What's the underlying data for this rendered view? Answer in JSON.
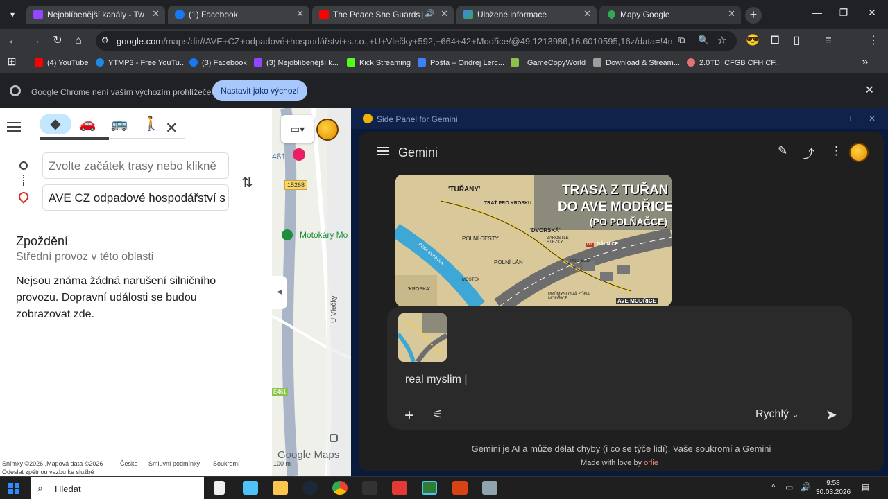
{
  "tabs": [
    {
      "title": "Nejoblíbenější kanály - Twitch",
      "color": "#9146ff"
    },
    {
      "title": "(1) Facebook",
      "color": "#1877f2"
    },
    {
      "title": "The Peace She Guards | Am",
      "color": "#ff0000"
    },
    {
      "title": "Uložené informace",
      "color": "#4285f4"
    },
    {
      "title": "Mapy Google",
      "color": "#34a853"
    }
  ],
  "address": {
    "host": "google.com",
    "path": "/maps/dir//AVE+CZ+odpadové+hospodářství+s.r.o.,+U+Vlečky+592,+664+42+Modřice/@49.1213986,16.6010595,16z/data=!4m8!4m..."
  },
  "bookmarks": [
    {
      "label": "(4) YouTube",
      "color": "#ff0000"
    },
    {
      "label": "YTMP3 - Free YouTu...",
      "color": "#1e88e5"
    },
    {
      "label": "(3) Facebook",
      "color": "#1877f2"
    },
    {
      "label": "(3) Nejoblíbenější k...",
      "color": "#9146ff"
    },
    {
      "label": "Kick Streaming",
      "color": "#53fc18"
    },
    {
      "label": "Pošta – Ondrej Lerc...",
      "color": "#3b82f6"
    },
    {
      "label": "| GameCopyWorld",
      "color": "#8bc34a"
    },
    {
      "label": "Download & Stream...",
      "color": "#9e9e9e"
    },
    {
      "label": "2.0TDI CFGB CFH CF...",
      "color": "#e57373"
    }
  ],
  "default_bar": {
    "message": "Google Chrome není vaším výchozím prohlížečem",
    "button": "Nastavit jako výchozí"
  },
  "maps": {
    "origin_placeholder": "Zvolte začátek trasy nebo klikně",
    "destination_value": "AVE CZ odpadové hospodářství s",
    "delay_title": "Zpoždění",
    "delay_sub": "Střední provoz v této oblasti",
    "delay_body": "Nejsou známa žádná narušení silničního provozu. Dopravní události se budou zobrazovat zde.",
    "footer": {
      "images": "Snímky ©2026 ,Mapová data ©2026",
      "country": "Česko",
      "terms": "Smluvní podmínky",
      "privacy": "Soukromí",
      "feedback": "Odeslat zpětnou vazbu ke službě"
    },
    "map_labels": {
      "road_461": "461",
      "road_15268": "15268",
      "motokary": "Motokáry Mo",
      "e461": "E461",
      "u_vlecky": "U Vlečky",
      "google_logo": "Google Maps",
      "scale": "100 m"
    }
  },
  "gemini": {
    "header_title": "Side Panel for Gemini",
    "app_title": "Gemini",
    "image_texts": {
      "headline1": "TRASA Z TUŘAN",
      "headline2": "DO AVE MODŘICE",
      "headline3": "(PO POLŇAČCE)",
      "turany": "'TUŘANY'",
      "trat": "TRAŤ PRO KROSKU",
      "dvorska": "'DVORSKÁ'",
      "stezky": "ZAROSTLÉ STEZKY",
      "polni_cesty": "POLNÍ CESTY",
      "polni_lan": "POLNÍ LÁN",
      "reka": "ŘEKA SVRATKA",
      "mostek": "MOSTEK",
      "kroska": "'KROSKA'",
      "dalnice": "DÁLNICE",
      "d1": "D1",
      "podjezd": "PODJEZD",
      "prumysl": "PRŮMYSLOVÁ ZÓNA MODŘICE",
      "ave": "AVE MODŘICE"
    },
    "typed_text": "real myslim",
    "model": "Rychlý",
    "disclaimer": "Gemini je AI a může dělat chyby (i co se týče lidí).",
    "privacy_link": "Vaše soukromí a Gemini",
    "made_by": "Made with love by",
    "author": "orlie"
  },
  "taskbar": {
    "search": "Hledat",
    "time": "9:58",
    "date": "30.03.2026"
  }
}
